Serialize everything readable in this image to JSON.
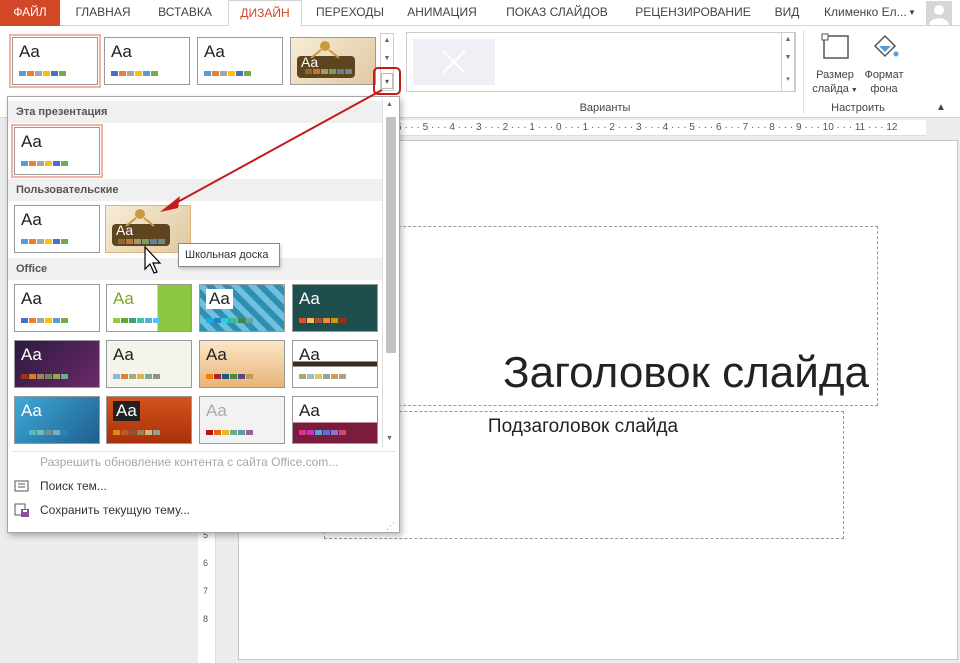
{
  "tabs": [
    {
      "label": "ФАЙЛ",
      "state": "file"
    },
    {
      "label": "ГЛАВНАЯ",
      "state": "normal"
    },
    {
      "label": "ВСТАВКА",
      "state": "normal"
    },
    {
      "label": "ДИЗАЙН",
      "state": "active"
    },
    {
      "label": "ПЕРЕХОДЫ",
      "state": "normal"
    },
    {
      "label": "АНИМАЦИЯ",
      "state": "normal"
    },
    {
      "label": "ПОКАЗ СЛАЙДОВ",
      "state": "normal"
    },
    {
      "label": "РЕЦЕНЗИРОВАНИЕ",
      "state": "normal"
    },
    {
      "label": "ВИД",
      "state": "normal"
    }
  ],
  "user": {
    "name": "Клименко Ел...",
    "arrow_icon": "dropdown-arrow-icon",
    "avatar_icon": "user-avatar-icon"
  },
  "ribbon": {
    "themes_thumb_text": "Aa",
    "variants_label": "Варианты",
    "customize_label": "Настроить",
    "slide_size": {
      "line1": "Размер",
      "line2": "слайда"
    },
    "format_background": {
      "line1": "Формат",
      "line2": "фона"
    }
  },
  "panel": {
    "sections": {
      "this_presentation": "Эта презентация",
      "custom": "Пользовательские",
      "office": "Office"
    },
    "thumb_text": "Aa",
    "tooltip": "Школьная доска",
    "menu": {
      "enable_updates": "Разрешить обновление контента с сайта Office.com...",
      "browse_themes": "Поиск тем...",
      "save_theme": "Сохранить текущую тему..."
    }
  },
  "slide": {
    "title": "Заголовок слайда",
    "subtitle": "Подзаголовок слайда"
  },
  "ruler": {
    "h": "6 · · · 5 · · · 4 · · · 3 · · · 2 · · · 1 · · · 0 · · · 1 · · · 2 · · · 3 · · · 4 · · · 5 · · · 6 · · · 7 · · · 8 · · · 9 · · · 10 · · · 11 · · · 12",
    "v": [
      "5",
      "6",
      "7",
      "8"
    ]
  },
  "colors": {
    "accent": "#d24726",
    "selection": "#f3b5a0",
    "annotation": "#c41a1a"
  }
}
